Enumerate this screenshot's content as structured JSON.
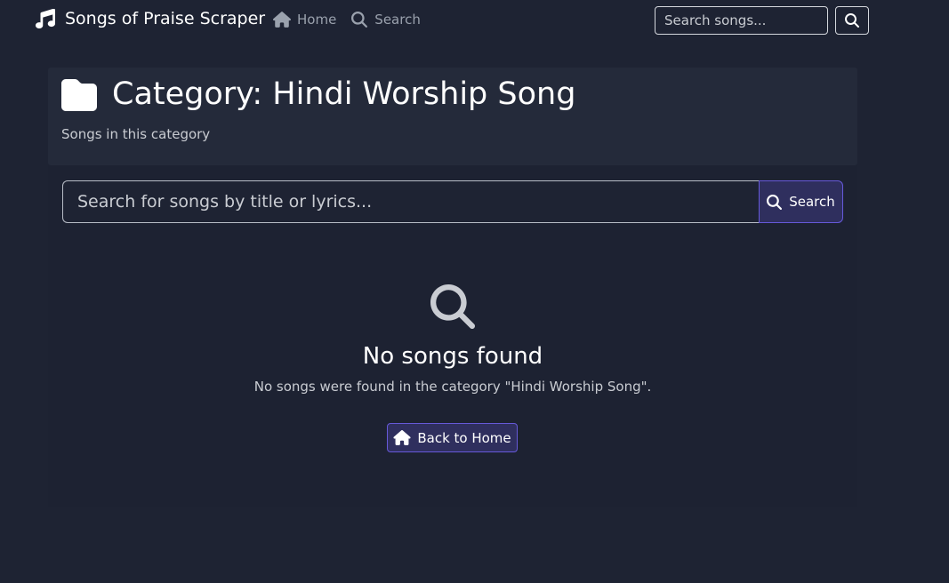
{
  "navbar": {
    "brand": "Songs of Praise Scraper",
    "links": [
      {
        "label": "Home",
        "icon": "home-icon"
      },
      {
        "label": "Search",
        "icon": "search-icon"
      }
    ],
    "search_placeholder": "Search songs..."
  },
  "header": {
    "title": "Category: Hindi Worship Song",
    "subtitle": "Songs in this category",
    "icon": "folder-icon"
  },
  "search": {
    "placeholder": "Search for songs by title or lyrics...",
    "button_label": "Search"
  },
  "empty_state": {
    "icon": "search-icon",
    "title": "No songs found",
    "message": "No songs were found in the category \"Hindi Worship Song\".",
    "button_label": "Back to Home",
    "button_icon": "home-icon"
  },
  "colors": {
    "background": "#1e2333",
    "card": "#242a3a",
    "accent_border": "#6659d9",
    "button_bg": "#2f2f5e",
    "muted_text": "#c9ccd2",
    "nav_link": "#9aa1ad"
  }
}
